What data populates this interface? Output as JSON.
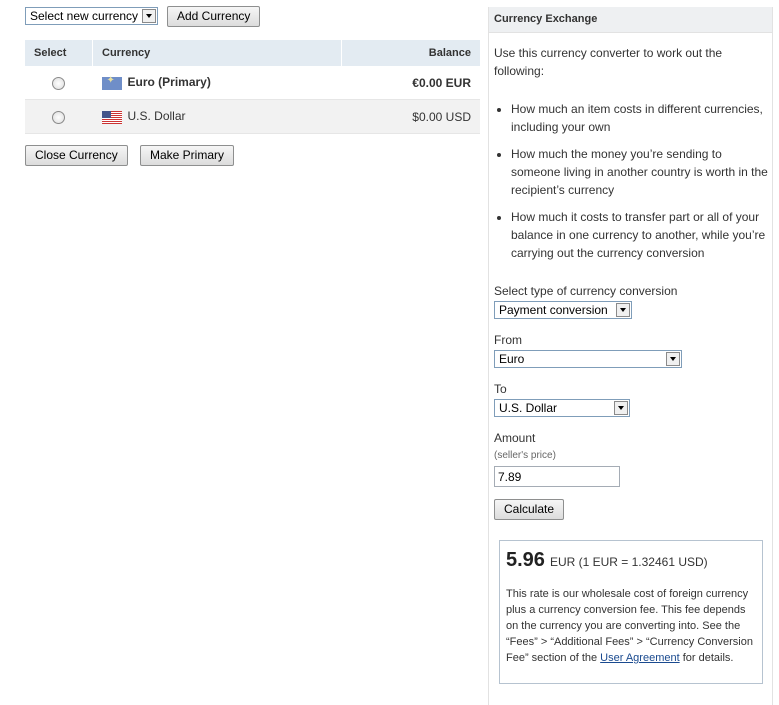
{
  "top_bar": {
    "currency_select": "Select new currency",
    "add_button": "Add Currency"
  },
  "table": {
    "headers": [
      "Select",
      "Currency",
      "Balance"
    ],
    "rows": [
      {
        "currency": "Euro (Primary)",
        "balance": "€0.00 EUR",
        "flag": "eu-flag-icon"
      },
      {
        "currency": "U.S. Dollar",
        "balance": "$0.00 USD",
        "flag": "us-flag-icon"
      }
    ]
  },
  "actions": {
    "close_button": "Close Currency",
    "primary_button": "Make Primary"
  },
  "exchange": {
    "title": "Currency Exchange",
    "intro": "Use this currency converter to work out the following:",
    "bullets": [
      "How much an item costs in different currencies, including your own",
      "How much the money you’re sending to someone living in another country is worth in the recipient’s currency",
      "How much it costs to transfer part or all of your balance in one currency to another, while you’re carrying out the currency conversion"
    ],
    "type_label": "Select type of currency conversion",
    "type_value": "Payment conversion",
    "from_label": "From",
    "from_value": "Euro",
    "to_label": "To",
    "to_value": "U.S. Dollar",
    "amount_label": "Amount",
    "amount_hint": "(seller's price)",
    "amount_value": "7.89",
    "calculate_button": "Calculate",
    "result_value": "5.96",
    "result_rate": "EUR (1 EUR = 1.32461  USD)",
    "note_text": "This rate is our wholesale cost of foreign currency plus a currency conversion fee. This fee depends on the currency you are converting into. See the “Fees” > “Additional Fees” > “Currency Conversion Fee” section of the",
    "note_link": "User Agreement",
    "note_end": "for details."
  }
}
